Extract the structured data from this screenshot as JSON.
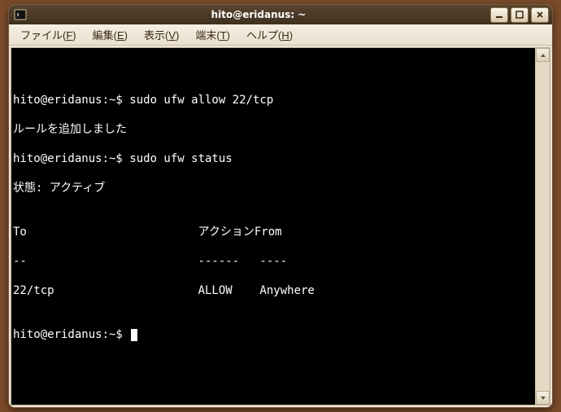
{
  "window": {
    "title": "hito@eridanus: ~"
  },
  "menubar": {
    "file": "ファイル(",
    "file_u": "F",
    "file_end": ")",
    "edit": "編集(",
    "edit_u": "E",
    "edit_end": ")",
    "view": "表示(",
    "view_u": "V",
    "view_end": ")",
    "terminal": "端末(",
    "terminal_u": "T",
    "terminal_end": ")",
    "help": "ヘルプ(",
    "help_u": "H",
    "help_end": ")"
  },
  "terminal": {
    "lines": [
      "hito@eridanus:~$ sudo ufw allow 22/tcp",
      "ルールを追加しました",
      "hito@eridanus:~$ sudo ufw status",
      "状態: アクティブ",
      "",
      "To                         アクションFrom",
      "--                         ------   ----",
      "22/tcp                     ALLOW    Anywhere",
      "",
      "hito@eridanus:~$ "
    ]
  },
  "colors": {
    "desktop_bg": "#7a4a2a",
    "titlebar_dark": "#3e2f1d",
    "terminal_bg": "#000000",
    "terminal_fg": "#ffffff",
    "chrome_bg": "#efe7da"
  }
}
